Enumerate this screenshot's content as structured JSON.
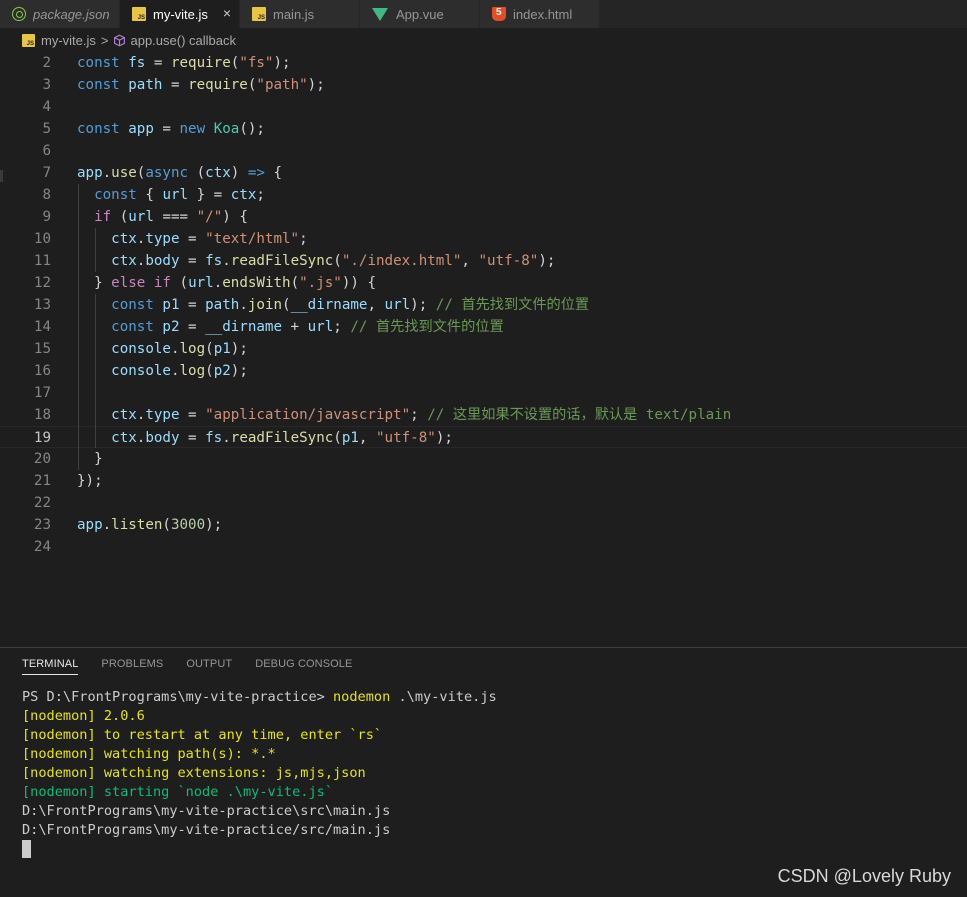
{
  "tabs": [
    {
      "label": "package.json",
      "icon": "node-icon",
      "active": false,
      "italic": true
    },
    {
      "label": "my-vite.js",
      "icon": "js-icon",
      "active": true,
      "close": "×"
    },
    {
      "label": "main.js",
      "icon": "js-icon",
      "active": false
    },
    {
      "label": "App.vue",
      "icon": "vue-icon",
      "active": false
    },
    {
      "label": "index.html",
      "icon": "html-icon",
      "active": false
    }
  ],
  "breadcrumb": {
    "file": "my-vite.js",
    "separator": ">",
    "symbol": "app.use() callback"
  },
  "editor": {
    "line_numbers": [
      "2",
      "3",
      "4",
      "5",
      "6",
      "7",
      "8",
      "9",
      "10",
      "11",
      "12",
      "13",
      "14",
      "15",
      "16",
      "17",
      "18",
      "19",
      "20",
      "21",
      "22",
      "23",
      "24"
    ],
    "current_line": "19",
    "lines": [
      [
        [
          "k",
          "const"
        ],
        [
          "",
          ""
        ],
        [
          "v",
          " fs"
        ],
        [
          "",
          " = "
        ],
        [
          "f",
          "require"
        ],
        [
          "",
          "("
        ],
        [
          "s",
          "\"fs\""
        ],
        [
          "",
          ");"
        ]
      ],
      [
        [
          "k",
          "const"
        ],
        [
          "v",
          " path"
        ],
        [
          "",
          " = "
        ],
        [
          "f",
          "require"
        ],
        [
          "",
          "("
        ],
        [
          "s",
          "\"path\""
        ],
        [
          "",
          ");"
        ]
      ],
      [],
      [
        [
          "k",
          "const"
        ],
        [
          "v",
          " app"
        ],
        [
          "",
          " = "
        ],
        [
          "k",
          "new"
        ],
        [
          "",
          " "
        ],
        [
          "t",
          "Koa"
        ],
        [
          "",
          "();"
        ]
      ],
      [],
      [
        [
          "v",
          "app"
        ],
        [
          "",
          "."
        ],
        [
          "f",
          "use"
        ],
        [
          "",
          "("
        ],
        [
          "k",
          "async"
        ],
        [
          "",
          " ("
        ],
        [
          "v",
          "ctx"
        ],
        [
          "",
          ") "
        ],
        [
          "k",
          "=>"
        ],
        [
          "",
          " {"
        ]
      ],
      [
        [
          "",
          "  "
        ],
        [
          "k",
          "const"
        ],
        [
          "",
          " { "
        ],
        [
          "v",
          "url"
        ],
        [
          "",
          " } = "
        ],
        [
          "v",
          "ctx"
        ],
        [
          "",
          ";"
        ]
      ],
      [
        [
          "",
          "  "
        ],
        [
          "c",
          "if"
        ],
        [
          "",
          " ("
        ],
        [
          "v",
          "url"
        ],
        [
          "",
          " === "
        ],
        [
          "s",
          "\"/\""
        ],
        [
          "",
          ") {"
        ]
      ],
      [
        [
          "",
          "    "
        ],
        [
          "v",
          "ctx"
        ],
        [
          "",
          "."
        ],
        [
          "v",
          "type"
        ],
        [
          "",
          " = "
        ],
        [
          "s",
          "\"text/html\""
        ],
        [
          "",
          ";"
        ]
      ],
      [
        [
          "",
          "    "
        ],
        [
          "v",
          "ctx"
        ],
        [
          "",
          "."
        ],
        [
          "v",
          "body"
        ],
        [
          "",
          " = "
        ],
        [
          "v",
          "fs"
        ],
        [
          "",
          "."
        ],
        [
          "f",
          "readFileSync"
        ],
        [
          "",
          "("
        ],
        [
          "s",
          "\"./index.html\""
        ],
        [
          "",
          ", "
        ],
        [
          "s",
          "\"utf-8\""
        ],
        [
          "",
          ");"
        ]
      ],
      [
        [
          "",
          "  } "
        ],
        [
          "c",
          "else"
        ],
        [
          "",
          " "
        ],
        [
          "c",
          "if"
        ],
        [
          "",
          " ("
        ],
        [
          "v",
          "url"
        ],
        [
          "",
          "."
        ],
        [
          "f",
          "endsWith"
        ],
        [
          "",
          "("
        ],
        [
          "s",
          "\".js\""
        ],
        [
          "",
          ")) {"
        ]
      ],
      [
        [
          "",
          "    "
        ],
        [
          "k",
          "const"
        ],
        [
          "v",
          " p1"
        ],
        [
          "",
          " = "
        ],
        [
          "v",
          "path"
        ],
        [
          "",
          "."
        ],
        [
          "f",
          "join"
        ],
        [
          "",
          "("
        ],
        [
          "v",
          "__dirname"
        ],
        [
          "",
          ", "
        ],
        [
          "v",
          "url"
        ],
        [
          "",
          "); "
        ],
        [
          "cm",
          "// 首先找到文件的位置"
        ]
      ],
      [
        [
          "",
          "    "
        ],
        [
          "k",
          "const"
        ],
        [
          "v",
          " p2"
        ],
        [
          "",
          " = "
        ],
        [
          "v",
          "__dirname"
        ],
        [
          "",
          " + "
        ],
        [
          "v",
          "url"
        ],
        [
          "",
          "; "
        ],
        [
          "cm",
          "// 首先找到文件的位置"
        ]
      ],
      [
        [
          "",
          "    "
        ],
        [
          "v",
          "console"
        ],
        [
          "",
          "."
        ],
        [
          "f",
          "log"
        ],
        [
          "",
          "("
        ],
        [
          "v",
          "p1"
        ],
        [
          "",
          ");"
        ]
      ],
      [
        [
          "",
          "    "
        ],
        [
          "v",
          "console"
        ],
        [
          "",
          "."
        ],
        [
          "f",
          "log"
        ],
        [
          "",
          "("
        ],
        [
          "v",
          "p2"
        ],
        [
          "",
          ");"
        ]
      ],
      [],
      [
        [
          "",
          "    "
        ],
        [
          "v",
          "ctx"
        ],
        [
          "",
          "."
        ],
        [
          "v",
          "type"
        ],
        [
          "",
          " = "
        ],
        [
          "s",
          "\"application/javascript\""
        ],
        [
          "",
          "; "
        ],
        [
          "cm",
          "// 这里如果不设置的话，默认是 text/plain"
        ]
      ],
      [
        [
          "",
          "    "
        ],
        [
          "v",
          "ctx"
        ],
        [
          "",
          "."
        ],
        [
          "v",
          "body"
        ],
        [
          "",
          " = "
        ],
        [
          "v",
          "fs"
        ],
        [
          "",
          "."
        ],
        [
          "f",
          "readFileSync"
        ],
        [
          "",
          "("
        ],
        [
          "v",
          "p1"
        ],
        [
          "",
          ", "
        ],
        [
          "s",
          "\"utf-8\""
        ],
        [
          "",
          ");"
        ]
      ],
      [
        [
          "",
          "  }"
        ]
      ],
      [
        [
          "",
          "});"
        ]
      ],
      [],
      [
        [
          "v",
          "app"
        ],
        [
          "",
          "."
        ],
        [
          "f",
          "listen"
        ],
        [
          "",
          "("
        ],
        [
          "n",
          "3000"
        ],
        [
          "",
          ");"
        ]
      ],
      []
    ]
  },
  "panel": {
    "tabs": [
      "TERMINAL",
      "PROBLEMS",
      "OUTPUT",
      "DEBUG CONSOLE"
    ],
    "active_tab": "TERMINAL",
    "terminal": {
      "prompt": "PS D:\\FrontPrograms\\my-vite-practice> ",
      "command": "nodemon",
      "command_args": " .\\my-vite.js",
      "lines": [
        {
          "text": "[nodemon] 2.0.6",
          "color": "yellow"
        },
        {
          "text": "[nodemon] to restart at any time, enter `rs`",
          "color": "yellow"
        },
        {
          "text": "[nodemon] watching path(s): *.*",
          "color": "yellow"
        },
        {
          "text": "[nodemon] watching extensions: js,mjs,json",
          "color": "yellow"
        },
        {
          "text": "[nodemon] starting `node .\\my-vite.js`",
          "color": "green"
        },
        {
          "text": "D:\\FrontPrograms\\my-vite-practice\\src\\main.js",
          "color": "default"
        },
        {
          "text": "D:\\FrontPrograms\\my-vite-practice/src/main.js",
          "color": "default"
        }
      ]
    }
  },
  "watermark": "CSDN @Lovely Ruby"
}
